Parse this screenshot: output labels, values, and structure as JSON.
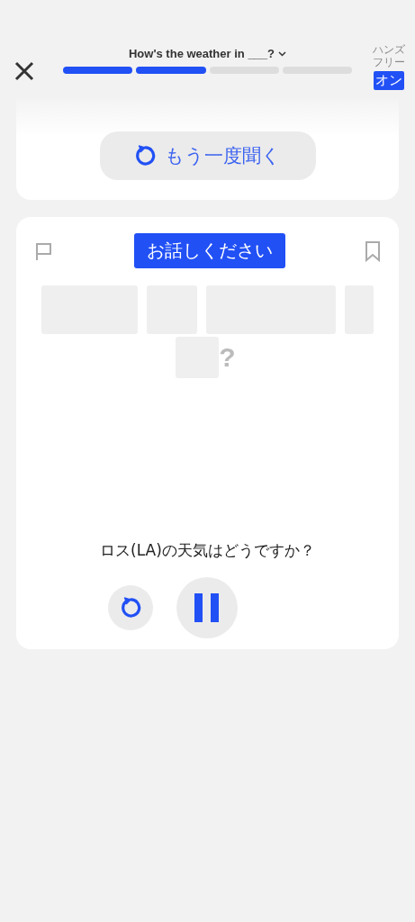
{
  "header": {
    "title": "How's the weather in ___?",
    "progress": [
      {
        "done": true
      },
      {
        "done": true
      },
      {
        "done": false
      },
      {
        "done": false
      }
    ],
    "hands_free": {
      "label": "ハンズフリー",
      "state_text": "オン",
      "on": true
    }
  },
  "replay_card": {
    "button": "もう一度聞く"
  },
  "speak_card": {
    "badge": "お話しください",
    "answer_end": "?",
    "sentence": "ロス(LA)の天気はどうですか？",
    "paused": false
  }
}
